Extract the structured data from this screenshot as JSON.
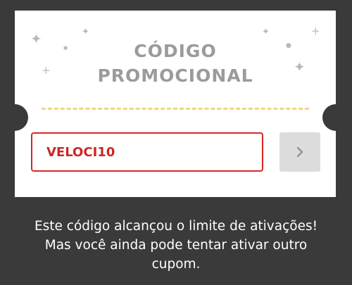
{
  "coupon": {
    "title_line1": "CÓDIGO",
    "title_line2": "PROMOCIONAL",
    "input_value": "VELOCI10",
    "submit_icon": "chevron-right-icon"
  },
  "message": {
    "line1": "Este código alcançou o limite de ativações!",
    "line2": "Mas você ainda pode tentar ativar outro",
    "line3": "cupom."
  },
  "colors": {
    "background": "#3a3a3a",
    "card": "#ffffff",
    "title": "#9b9b9b",
    "error": "#d62828",
    "dash": "#f2d878",
    "button": "#dcdcdc"
  }
}
